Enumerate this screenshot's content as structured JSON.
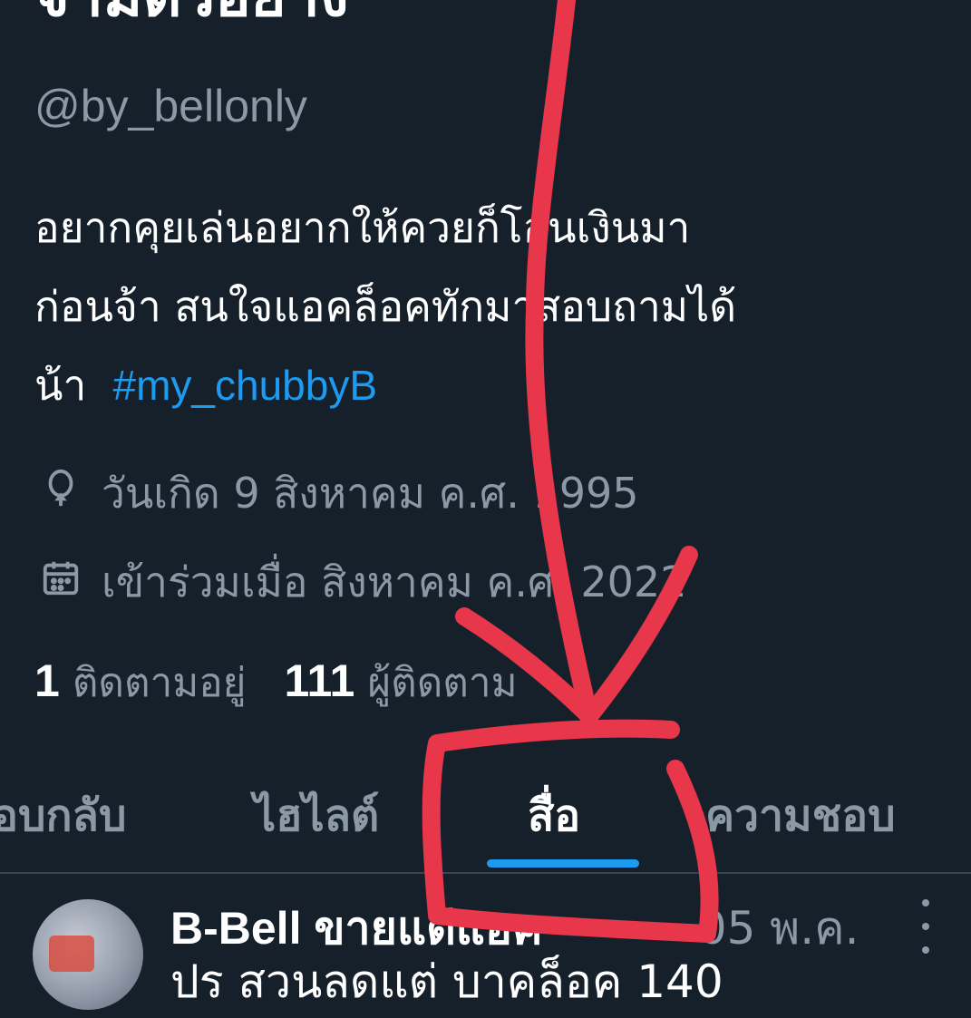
{
  "profile": {
    "name": "จ้ามีตัวอย่าง",
    "handle": "@by_bellonly",
    "bio_line1": "อยากคุยเล่นอยากให้ควยก็โอนเงินมา",
    "bio_line2": "ก่อนจ้า  สนใจแอคล็อคทักมาสอบถามได้",
    "bio_line3": "น้า",
    "hashtag": "#my_chubbyB",
    "birthday": "วันเกิด 9 สิงหาคม ค.ศ. 1995",
    "joined": "เข้าร่วมเมื่อ สิงหาคม ค.ศ. 2022",
    "following_count": "1",
    "following_label": "ติดตามอยู่",
    "followers_count": "111",
    "followers_label": "ผู้ติดตาม"
  },
  "tabs": [
    {
      "label": "ตอบกลับ"
    },
    {
      "label": "ไฮไลต์"
    },
    {
      "label": "สื่อ",
      "active": true
    },
    {
      "label": "ความชอบ"
    }
  ],
  "tweet": {
    "author": "B-Bell ขายแต่แอค",
    "date": "· 05 พ.ค.",
    "text": "ปร สวนลดแต่ บาคล็อค 140"
  },
  "icons": {
    "birthday": "balloon-icon",
    "joined": "calendar-icon",
    "more": "more-vertical-icon"
  },
  "colors": {
    "background": "#15202b",
    "accent": "#1d9bf0",
    "secondary_text": "#8b98a5",
    "annotation": "#e8364a"
  }
}
